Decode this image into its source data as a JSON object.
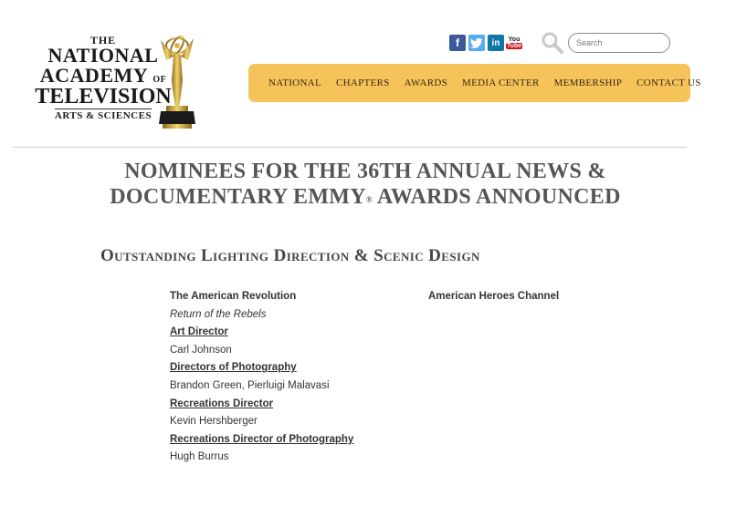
{
  "logo": {
    "line1": "THE",
    "line2": "NATIONAL",
    "line3": "ACADEMY",
    "line3_suffix": "OF",
    "line4": "TELEVISION",
    "line5": "ARTS & SCIENCES"
  },
  "social": {
    "facebook": "f",
    "twitter": "t",
    "linkedin": "in",
    "youtube_top": "You",
    "youtube_bottom": "Tube"
  },
  "search": {
    "placeholder": "Search",
    "value": ""
  },
  "nav": {
    "items": [
      {
        "label": "NATIONAL"
      },
      {
        "label": "CHAPTERS"
      },
      {
        "label": "AWARDS"
      },
      {
        "label": "MEDIA CENTER"
      },
      {
        "label": "MEMBERSHIP"
      },
      {
        "label": "CONTACT US"
      }
    ],
    "bg_color": "#f6c35a"
  },
  "headline": {
    "line1": "NOMINEES FOR THE 36TH ANNUAL NEWS &",
    "line2_part1": "DOCUMENTARY EMMY",
    "line2_sup": "®",
    "line2_part2": " AWARDS ANNOUNCED"
  },
  "category": "Outstanding Lighting Direction & Scenic Design",
  "nominee": {
    "program": "The American Revolution",
    "episode": "Return of the Rebels",
    "network": "American Heroes Channel",
    "credits": [
      {
        "role": "Art Director",
        "names": "Carl Johnson"
      },
      {
        "role": "Directors of Photography",
        "names": "Brandon Green, Pierluigi Malavasi"
      },
      {
        "role": "Recreations Director",
        "names": "Kevin Hershberger"
      },
      {
        "role": "Recreations Director of Photography",
        "names": "Hugh Burrus"
      }
    ]
  }
}
